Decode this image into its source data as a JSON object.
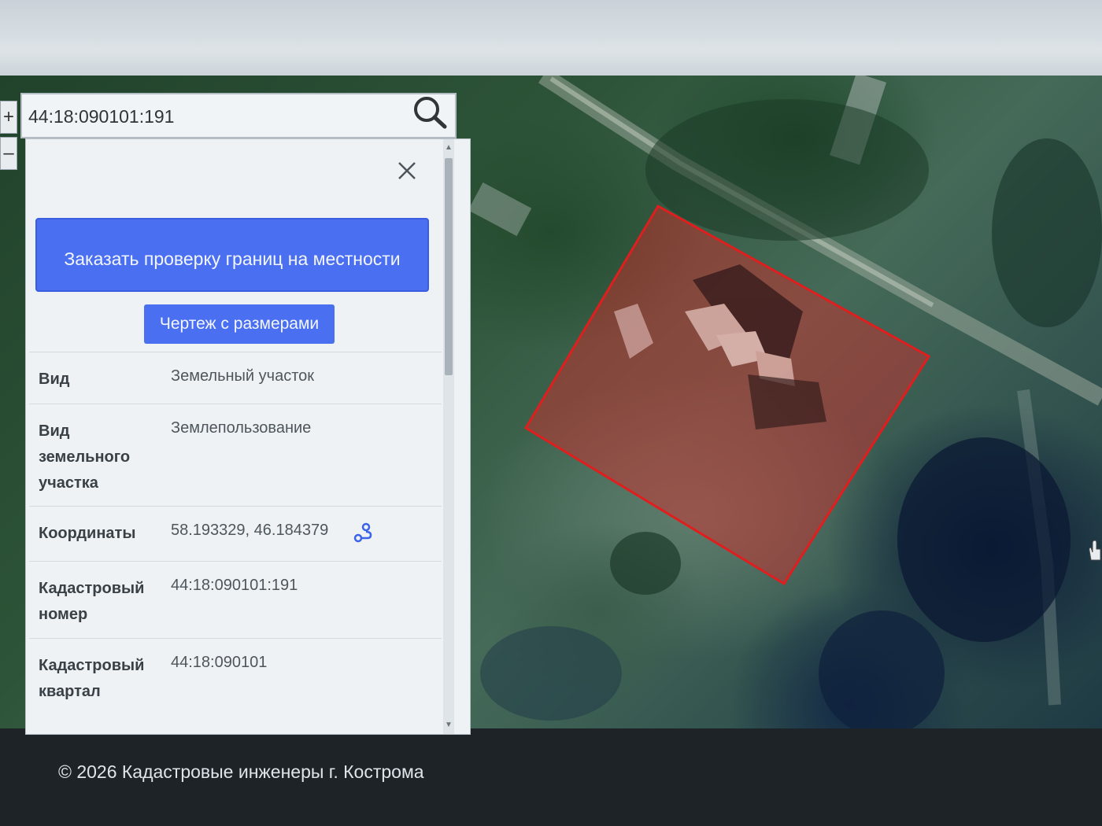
{
  "search": {
    "value": "44:18:090101:191"
  },
  "zoom": {
    "in_label": "+",
    "out_label": "–"
  },
  "panel": {
    "order_button_label": "Заказать проверку границ на местности",
    "drawing_button_label": "Чертеж с размерами",
    "rows": [
      {
        "label": "Вид",
        "value": "Земельный участок"
      },
      {
        "label": "Вид земельного участка",
        "value": "Землепользование"
      },
      {
        "label": "Координаты",
        "value": "58.193329, 46.184379"
      },
      {
        "label": "Кадастровый номер",
        "value": "44:18:090101:191"
      },
      {
        "label": "Кадастровый квартал",
        "value": "44:18:090101"
      }
    ]
  },
  "map": {
    "parcel_color": "#e01e1e",
    "parcel_fill": "rgba(220,40,40,0.45)"
  },
  "footer": {
    "copyright": "© 2026 Кадастровые инженеры г. Кострома"
  },
  "icons": {
    "search": "search-icon",
    "close": "close-icon",
    "route": "route-icon",
    "hand": "hand-cursor-icon"
  },
  "colors": {
    "accent": "#4a6ff0",
    "panel_bg": "#eef2f5"
  }
}
